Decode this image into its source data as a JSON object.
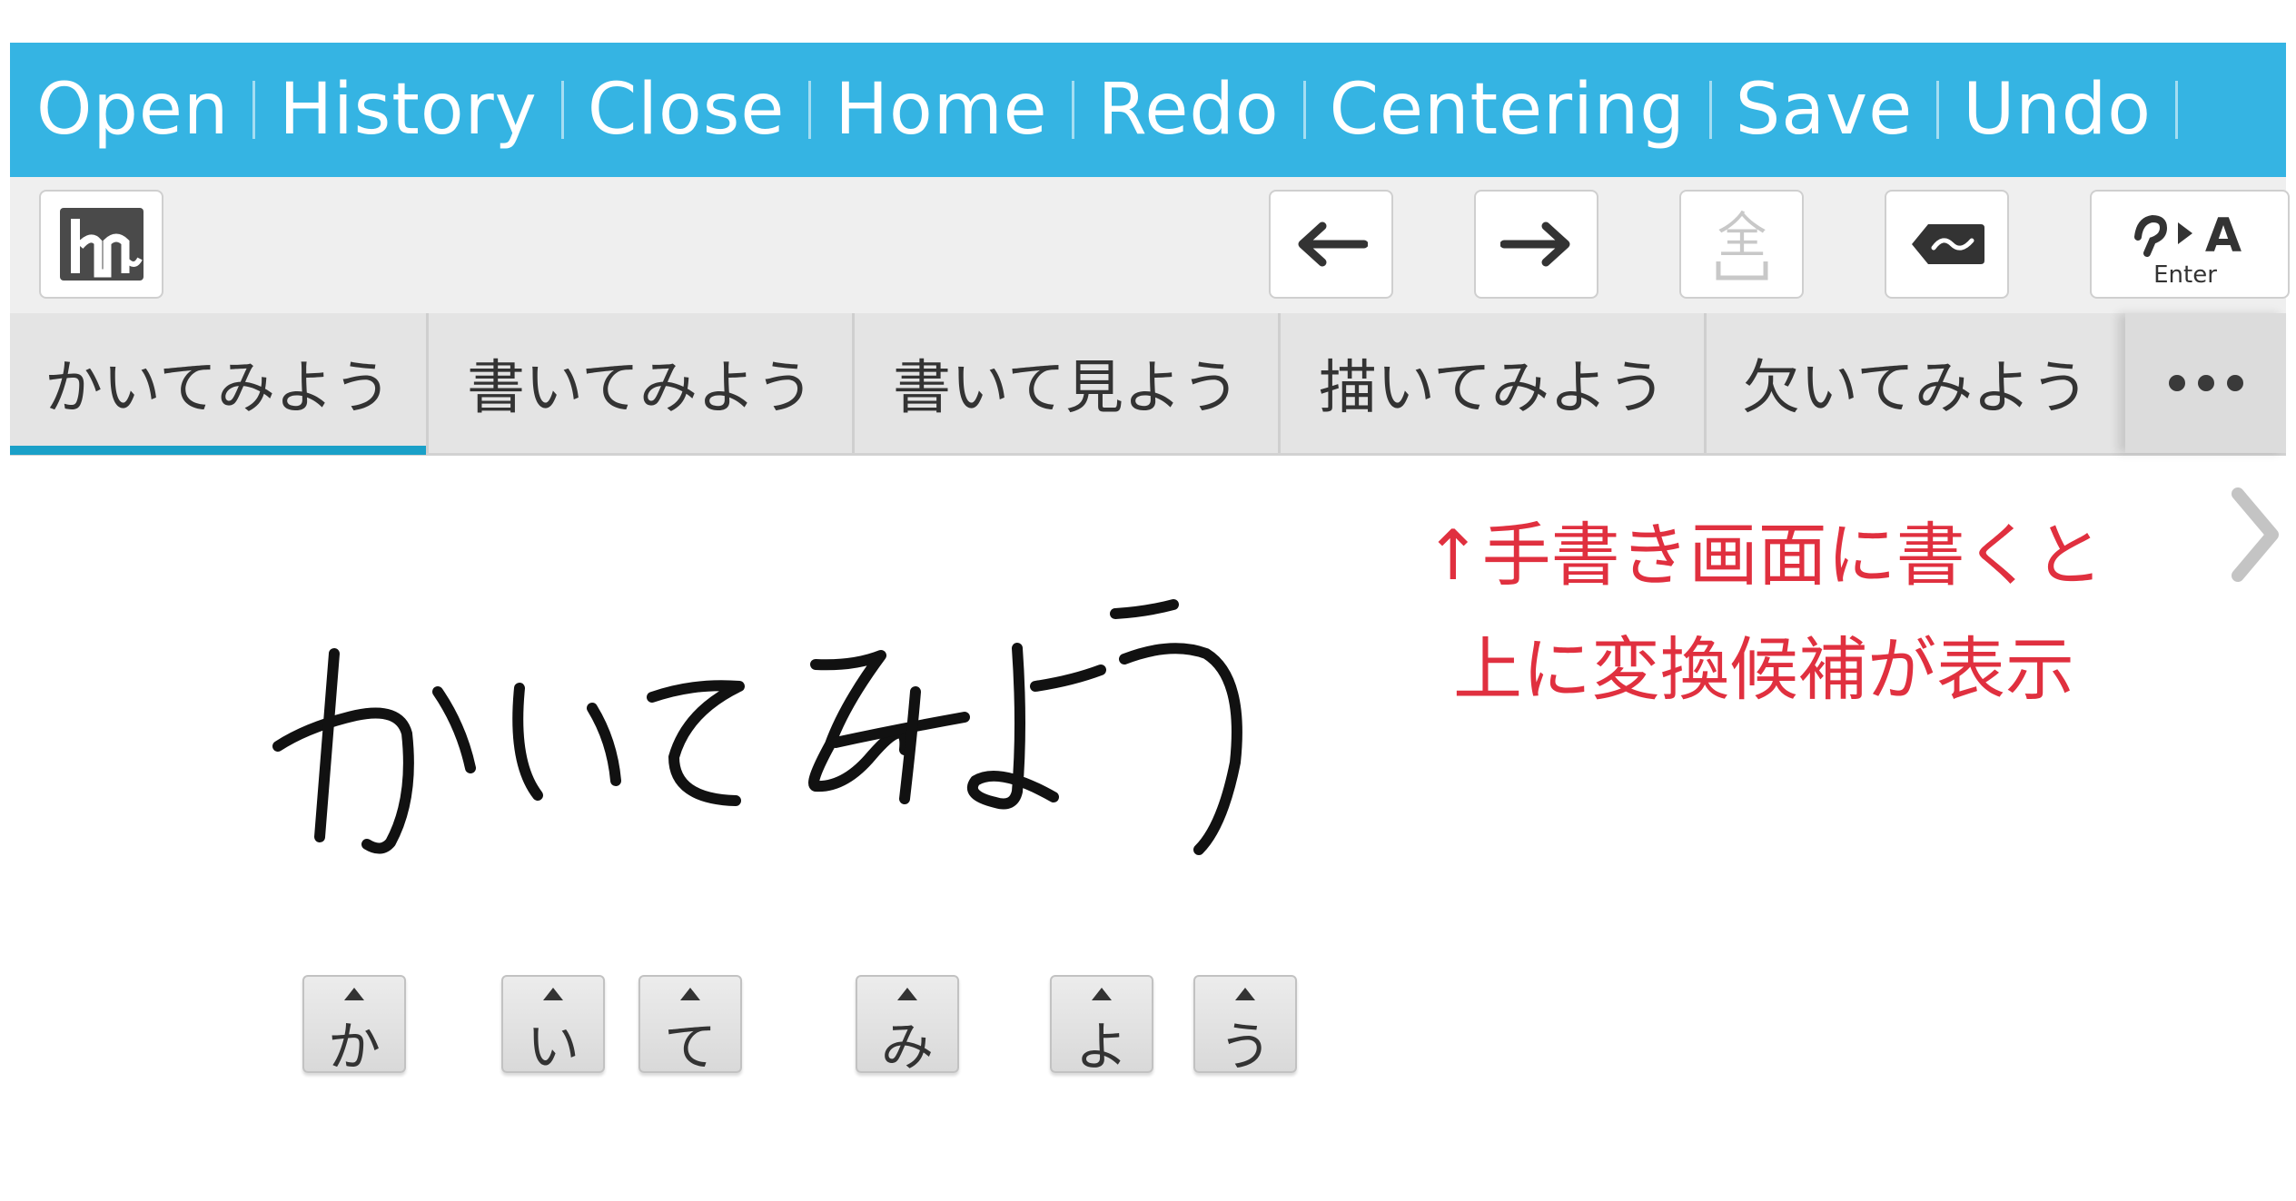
{
  "menu": {
    "items": [
      "Open",
      "History",
      "Close",
      "Home",
      "Redo",
      "Centering",
      "Save",
      "Undo"
    ]
  },
  "toolbar": {
    "buttons": [
      {
        "icon": "handwriting-mode-icon"
      },
      {
        "icon": "arrow-left-icon"
      },
      {
        "icon": "arrow-right-icon"
      },
      {
        "icon": "fullwidth-toggle-icon",
        "glyph": "全",
        "disabled": true
      },
      {
        "icon": "backspace-icon"
      },
      {
        "icon": "enter-icon",
        "label": "Enter"
      }
    ]
  },
  "candidates": {
    "items": [
      "かいてみよう",
      "書いてみよう",
      "書いて見よう",
      "描いてみよう",
      "欠いてみよう"
    ],
    "selected_index": 0
  },
  "annotation": {
    "line1": "↑手書き画面に書くと",
    "line2": "上に変換候補が表示"
  },
  "char_keys": [
    "か",
    "い",
    "て",
    "み",
    "よ",
    "う"
  ],
  "colors": {
    "menubar_bg": "#35b4e3",
    "accent_underline": "#1aa0c8",
    "annotation": "#e0303f"
  }
}
